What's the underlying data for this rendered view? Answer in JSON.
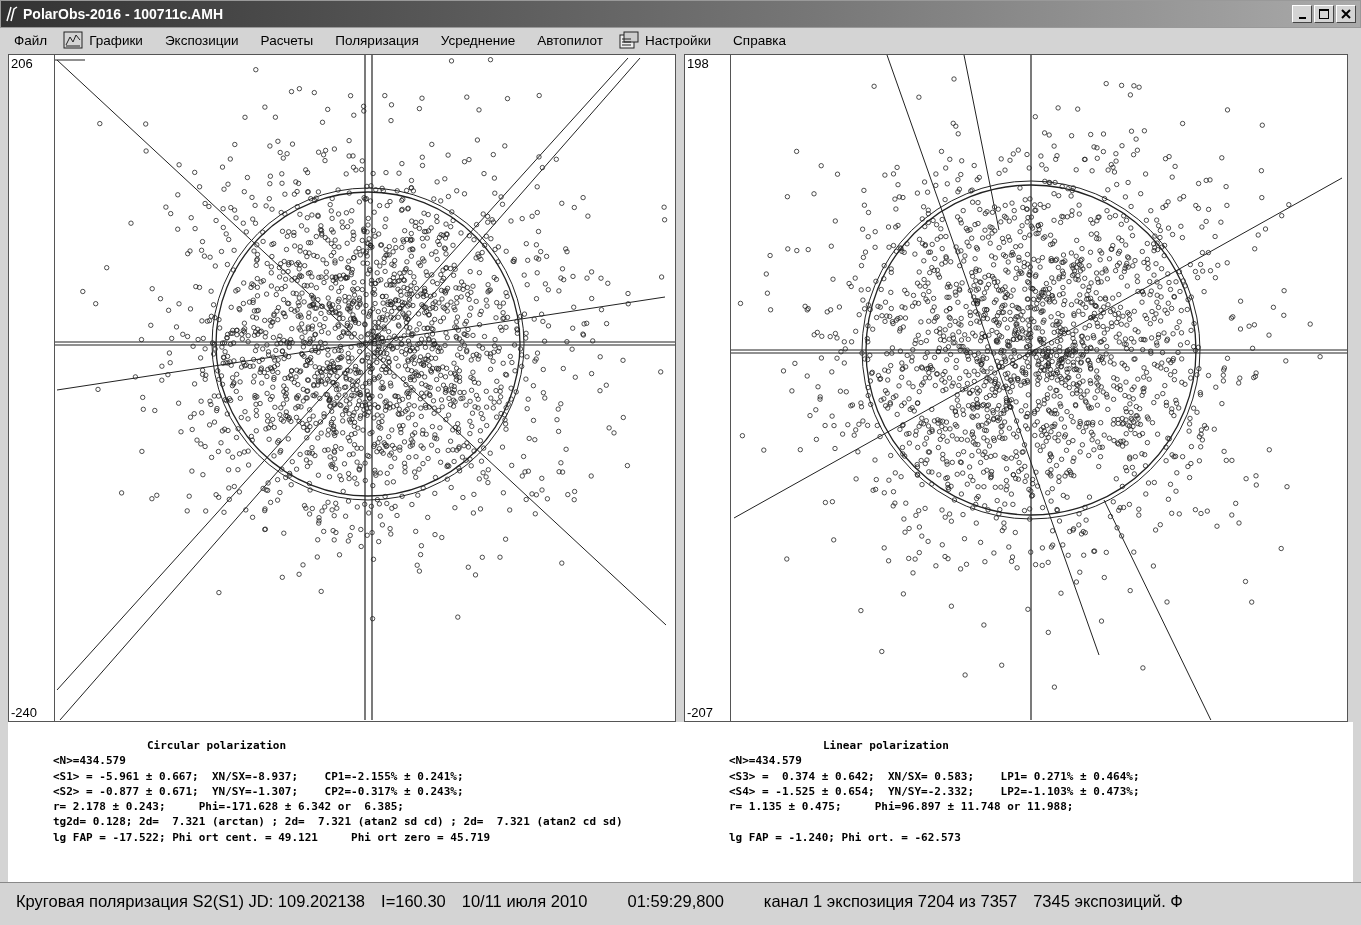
{
  "window": {
    "title": "PolarObs-2016 - 100711c.AMH"
  },
  "menu": [
    {
      "label": "Файл"
    },
    {
      "label": "Графики",
      "kind": "chart"
    },
    {
      "label": "Экспозиции"
    },
    {
      "label": "Расчеты"
    },
    {
      "label": "Поляризация"
    },
    {
      "label": "Усреднение"
    },
    {
      "label": "Автопилот"
    },
    {
      "label": "Настройки",
      "kind": "settings"
    },
    {
      "label": "Справка"
    }
  ],
  "plots": [
    {
      "y_max": "206",
      "y_min": "-240"
    },
    {
      "y_max": "198",
      "y_min": "-207"
    }
  ],
  "stats": [
    {
      "title": "Circular polarization",
      "lines": [
        "<N>=434.579",
        "<S1> = -5.961 ± 0.667;  XN/SX=-8.937;    CP1=-2.155% ± 0.241%;",
        "<S2> = -0.877 ± 0.671;  YN/SY=-1.307;    CP2=-0.317% ± 0.243%;",
        "r= 2.178 ± 0.243;     Phi=-171.628 ± 6.342 or  6.385;",
        "tg2d= 0.128; 2d=  7.321 (arctan) ; 2d=  7.321 (atan2 sd cd) ; 2d=  7.321 (atan2 cd sd)"
      ],
      "footer": "lg FAP = -17.522; Phi ort cent. = 49.121     Phi ort zero = 45.719"
    },
    {
      "title": "Linear polarization",
      "lines": [
        "<N>=434.579",
        "<S3> =  0.374 ± 0.642;  XN/SX= 0.583;    LP1= 0.271% ± 0.464%;",
        "<S4> = -1.525 ± 0.654;  YN/SY=-2.332;    LP2=-1.103% ± 0.473%;",
        "r= 1.135 ± 0.475;     Phi=96.897 ± 11.748 or 11.988;"
      ],
      "footer": "lg FAP = -1.240; Phi ort. = -62.573",
      "footer_gap": true
    }
  ],
  "status_bar": [
    "Круговая поляризация S2(S1) JD: 109.202138",
    "I=160.30",
    "10/11 июля 2010",
    "01:59:29,800",
    "канал 1 экспозиция 7204 из 7357",
    "7345 экспозиций. Ф"
  ]
}
